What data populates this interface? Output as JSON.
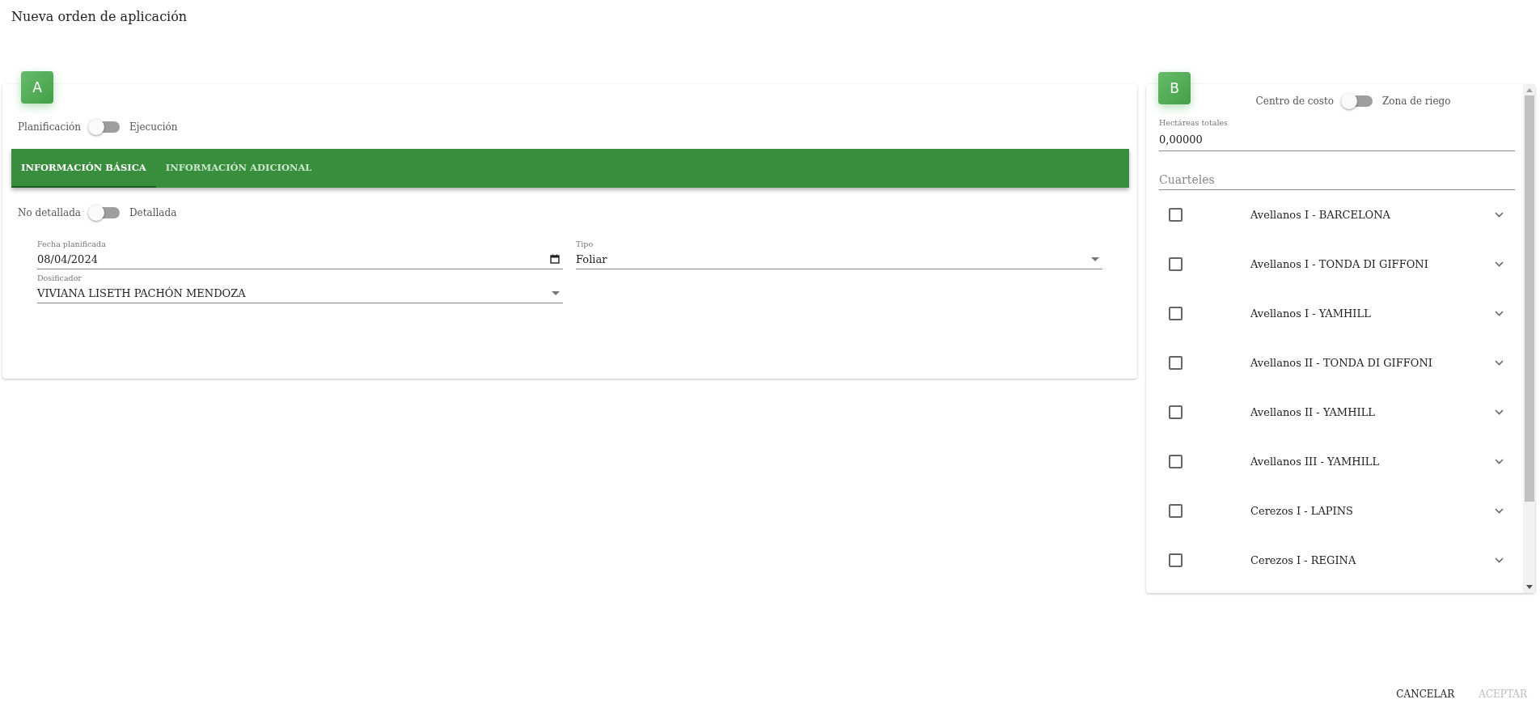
{
  "title": "Nueva orden de aplicación",
  "panel_a": {
    "badge": "A",
    "mode_toggle": {
      "left_label": "Planificación",
      "right_label": "Ejecución",
      "on": false
    },
    "tabs": [
      {
        "label": "INFORMACIÓN BÁSICA",
        "selected": true
      },
      {
        "label": "INFORMACIÓN ADICIONAL",
        "selected": false
      }
    ],
    "detail_toggle": {
      "left_label": "No detallada",
      "right_label": "Detallada",
      "on": false
    },
    "fields": [
      {
        "kind": "date",
        "label": "Fecha planificada",
        "value": "08/04/2024"
      },
      {
        "kind": "select",
        "label": "Tipo",
        "value": "Foliar"
      },
      {
        "kind": "select",
        "label": "Dosificador",
        "value": "VIVIANA LISETH PACHÓN MENDOZA"
      }
    ]
  },
  "panel_b": {
    "badge": "B",
    "scope_toggle": {
      "left_label": "Centro de costo",
      "right_label": "Zona de riego",
      "on": false
    },
    "hectares": {
      "label": "Hectáreas totales",
      "value": "0,00000"
    },
    "cuarteles": {
      "placeholder": "Cuarteles"
    },
    "items": [
      {
        "label": "Avellanos I - BARCELONA",
        "checked": false,
        "expanded": false
      },
      {
        "label": "Avellanos I - TONDA DI GIFFONI",
        "checked": false,
        "expanded": false
      },
      {
        "label": "Avellanos I - YAMHILL",
        "checked": false,
        "expanded": false
      },
      {
        "label": "Avellanos II - TONDA DI GIFFONI",
        "checked": false,
        "expanded": false
      },
      {
        "label": "Avellanos II - YAMHILL",
        "checked": false,
        "expanded": false
      },
      {
        "label": "Avellanos III - YAMHILL",
        "checked": false,
        "expanded": false
      },
      {
        "label": "Cerezos I - LAPINS",
        "checked": false,
        "expanded": false
      },
      {
        "label": "Cerezos I - REGINA",
        "checked": false,
        "expanded": false
      }
    ]
  },
  "actions": [
    {
      "label": "CANCELAR",
      "disabled": false
    },
    {
      "label": "ACEPTAR",
      "disabled": true
    }
  ]
}
